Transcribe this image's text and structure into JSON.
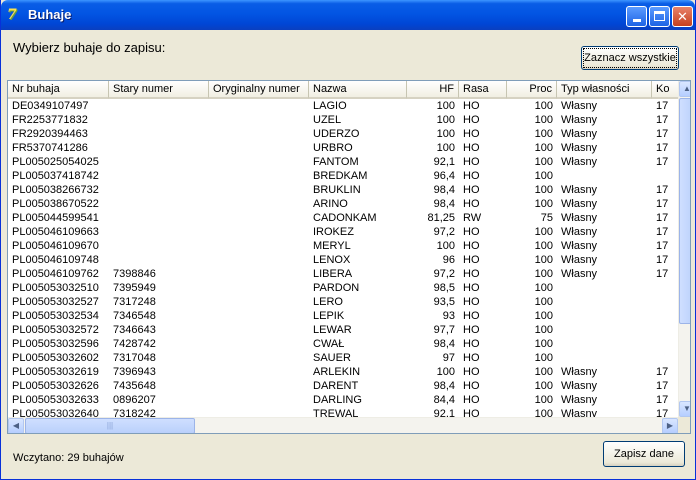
{
  "window": {
    "title": "Buhaje",
    "app_icon_glyph": "7"
  },
  "prompt": "Wybierz buhaje do zapisu:",
  "buttons": {
    "select_all": "Zaznacz wszystkie",
    "save": "Zapisz dane"
  },
  "status": "Wczytano: 29 buhajów",
  "table": {
    "columns": [
      "Nr buhaja",
      "Stary numer",
      "Oryginalny numer",
      "Nazwa",
      "HF",
      "Rasa",
      "Proc",
      "Typ własności",
      "Ko"
    ],
    "rows": [
      [
        "DE0349107497",
        "",
        "",
        "LAGIO",
        "100",
        "HO",
        "100",
        "Własny",
        "17"
      ],
      [
        "FR2253771832",
        "",
        "",
        "UZEL",
        "100",
        "HO",
        "100",
        "Własny",
        "17"
      ],
      [
        "FR2920394463",
        "",
        "",
        "UDERZO",
        "100",
        "HO",
        "100",
        "Własny",
        "17"
      ],
      [
        "FR5370741286",
        "",
        "",
        "URBRO",
        "100",
        "HO",
        "100",
        "Własny",
        "17"
      ],
      [
        "PL005025054025",
        "",
        "",
        "FANTOM",
        "92,1",
        "HO",
        "100",
        "Własny",
        "17"
      ],
      [
        "PL005037418742",
        "",
        "",
        "BREDKAM",
        "96,4",
        "HO",
        "100",
        "",
        ""
      ],
      [
        "PL005038266732",
        "",
        "",
        "BRUKLIN",
        "98,4",
        "HO",
        "100",
        "Własny",
        "17"
      ],
      [
        "PL005038670522",
        "",
        "",
        "ARINO",
        "98,4",
        "HO",
        "100",
        "Własny",
        "17"
      ],
      [
        "PL005044599541",
        "",
        "",
        "CADONKAM",
        "81,25",
        "RW",
        "75",
        "Własny",
        "17"
      ],
      [
        "PL005046109663",
        "",
        "",
        "IROKEZ",
        "97,2",
        "HO",
        "100",
        "Własny",
        "17"
      ],
      [
        "PL005046109670",
        "",
        "",
        "MERYL",
        "100",
        "HO",
        "100",
        "Własny",
        "17"
      ],
      [
        "PL005046109748",
        "",
        "",
        "LENOX",
        "96",
        "HO",
        "100",
        "Własny",
        "17"
      ],
      [
        "PL005046109762",
        "7398846",
        "",
        "LIBERA",
        "97,2",
        "HO",
        "100",
        "Własny",
        "17"
      ],
      [
        "PL005053032510",
        "7395949",
        "",
        "PARDON",
        "98,5",
        "HO",
        "100",
        "",
        ""
      ],
      [
        "PL005053032527",
        "7317248",
        "",
        "LERO",
        "93,5",
        "HO",
        "100",
        "",
        ""
      ],
      [
        "PL005053032534",
        "7346548",
        "",
        "LEPIK",
        "93",
        "HO",
        "100",
        "",
        ""
      ],
      [
        "PL005053032572",
        "7346643",
        "",
        "LEWAR",
        "97,7",
        "HO",
        "100",
        "",
        ""
      ],
      [
        "PL005053032596",
        "7428742",
        "",
        "CWAŁ",
        "98,4",
        "HO",
        "100",
        "",
        ""
      ],
      [
        "PL005053032602",
        "7317048",
        "",
        "SAUER",
        "97",
        "HO",
        "100",
        "",
        ""
      ],
      [
        "PL005053032619",
        "7396943",
        "",
        "ARLEKIN",
        "100",
        "HO",
        "100",
        "Własny",
        "17"
      ],
      [
        "PL005053032626",
        "7435648",
        "",
        "DARENT",
        "98,4",
        "HO",
        "100",
        "Własny",
        "17"
      ],
      [
        "PL005053032633",
        "0896207",
        "",
        "DARLING",
        "84,4",
        "HO",
        "100",
        "Własny",
        "17"
      ],
      [
        "PL005053032640",
        "7318242",
        "",
        "TREWAL",
        "92,1",
        "HO",
        "100",
        "Własny",
        "17"
      ]
    ]
  },
  "icons": {
    "minimize": "minimize-icon",
    "maximize": "maximize-icon",
    "close": "close-icon",
    "scroll_up": "arrow-up-icon",
    "scroll_down": "arrow-down-icon",
    "scroll_left": "arrow-left-icon",
    "scroll_right": "arrow-right-icon",
    "close_glyph": "✕",
    "up_glyph": "▲",
    "down_glyph": "▼",
    "left_glyph": "◀",
    "right_glyph": "▶",
    "grip_glyph": "|||"
  },
  "colors": {
    "title_bar": "#0255e3",
    "face": "#ece9d8",
    "close_button": "#c5401e"
  }
}
